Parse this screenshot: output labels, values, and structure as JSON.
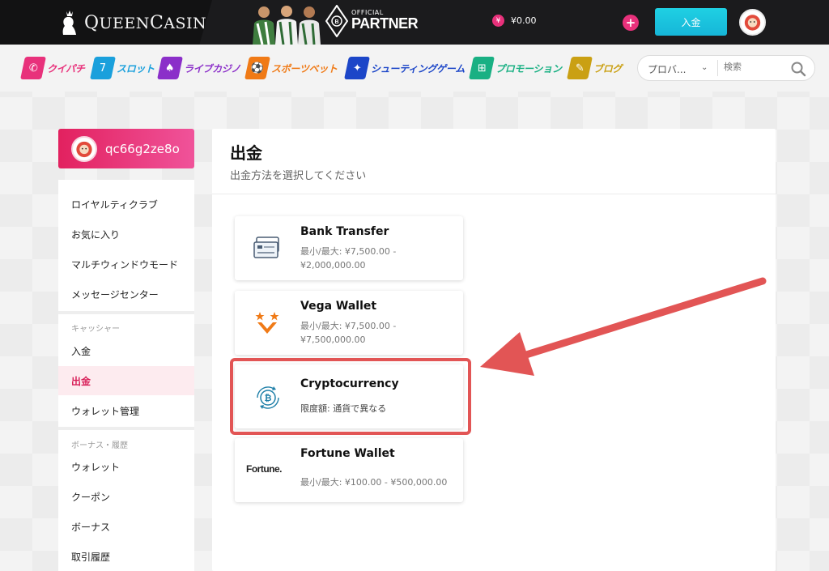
{
  "header": {
    "logo_text_q": "Q",
    "logo_text_ueen": "UEEN",
    "logo_text_c": "C",
    "logo_text_asino": "ASINO",
    "partner_small": "OFFICIAL",
    "partner_large": "PARTNER",
    "balance_currency": "¥",
    "balance": "¥0.00",
    "plus_label": "+",
    "deposit_label": "入金"
  },
  "nav": {
    "items": [
      {
        "label": "クイパチ",
        "icon": "phone-icon",
        "color": "#e8317b",
        "glyph": "✆"
      },
      {
        "label": "スロット",
        "icon": "slot-icon",
        "color": "#1aa0dc",
        "glyph": "7"
      },
      {
        "label": "ライブカジノ",
        "icon": "spade-icon",
        "color": "#8b2fc9",
        "glyph": "♠"
      },
      {
        "label": "スポーツベット",
        "icon": "soccer-ball-icon",
        "color": "#f07a16",
        "glyph": "⚽"
      },
      {
        "label": "シューティングゲーム",
        "icon": "fish-icon",
        "color": "#1c46c8",
        "glyph": "✦"
      },
      {
        "label": "プロモーション",
        "icon": "gift-icon",
        "color": "#19b083",
        "glyph": "⊞"
      },
      {
        "label": "ブログ",
        "icon": "blog-icon",
        "color": "#caa013",
        "glyph": "✎"
      }
    ],
    "provider_select": "プロバ...",
    "search_placeholder": "検索"
  },
  "sidebar": {
    "username": "qc66g2ze8o",
    "group1": [
      "ロイヤルティクラブ",
      "お気に入り",
      "マルチウィンドウモード",
      "メッセージセンター"
    ],
    "cashier_title": "キャッシャー",
    "cashier": [
      "入金",
      "出金",
      "ウォレット管理"
    ],
    "active_item": "出金",
    "bonus_title": "ボーナス・履歴",
    "bonus": [
      "ウォレット",
      "クーポン",
      "ボーナス",
      "取引履歴"
    ]
  },
  "main": {
    "title": "出金",
    "subtitle": "出金方法を選択してください",
    "methods": [
      {
        "name": "Bank Transfer",
        "limit_line1": "最小/最大: ¥7,500.00 -",
        "limit_line2": "¥2,000,000.00"
      },
      {
        "name": "Vega Wallet",
        "limit_line1": "最小/最大: ¥7,500.00 -",
        "limit_line2": "¥7,500,000.00"
      },
      {
        "name": "Cryptocurrency",
        "limit_line1": "限度額: 通貨で異なる",
        "limit_line2": ""
      },
      {
        "name": "Fortune Wallet",
        "limit_line1": "最小/最大: ¥100.00 - ¥500,000.00",
        "limit_line2": "",
        "logo_text": "Fortune."
      }
    ],
    "highlighted_method": "Cryptocurrency"
  },
  "colors": {
    "accent_pink": "#e8317b",
    "deposit_cyan": "#1fd0e3",
    "highlight_red": "#e25555"
  }
}
